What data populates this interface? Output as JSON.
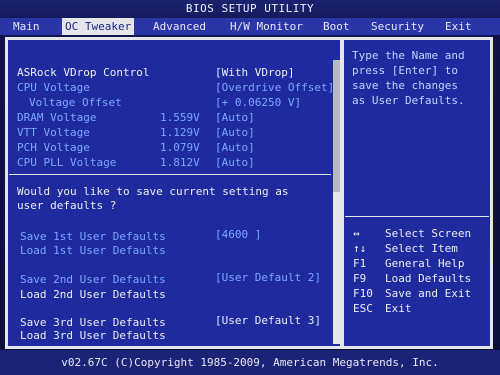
{
  "title": "BIOS SETUP UTILITY",
  "menu": [
    "Main",
    "OC Tweaker",
    "Advanced",
    "H/W Monitor",
    "Boot",
    "Security",
    "Exit"
  ],
  "settings": [
    {
      "label": "ASRock VDrop Control",
      "reading": "",
      "value": "[With VDrop]"
    },
    {
      "label": "CPU Voltage",
      "reading": "",
      "value": "[Overdrive Offset]"
    },
    {
      "label": "Voltage Offset",
      "reading": "",
      "value": "[+  0.06250 V]"
    },
    {
      "label": "DRAM Voltage",
      "reading": "1.559V",
      "value": "[Auto]"
    },
    {
      "label": "VTT Voltage",
      "reading": "1.129V",
      "value": "[Auto]"
    },
    {
      "label": "PCH Voltage",
      "reading": "1.079V",
      "value": "[Auto]"
    },
    {
      "label": "CPU PLL Voltage",
      "reading": "1.812V",
      "value": "[Auto]"
    }
  ],
  "save_prompt": [
    "Would you like to save current setting as",
    "user defaults ?"
  ],
  "user_defaults": [
    {
      "save_label": "Save 1st User Defaults",
      "save_value": "[4600        ]",
      "load_label": "Load 1st User Defaults"
    },
    {
      "save_label": "Save 2nd User Defaults",
      "save_value": "[User Default  2]",
      "load_label": "Load 2nd User Defaults"
    },
    {
      "save_label": "Save 3rd User Defaults",
      "save_value": "[User Default  3]",
      "load_label": "Load 3rd User Defaults"
    }
  ],
  "help_text": [
    "Type the Name and",
    "press [Enter] to",
    "save the changes",
    "as User Defaults."
  ],
  "keys": [
    {
      "key": "↔",
      "desc": "Select Screen"
    },
    {
      "key": "↑↓",
      "desc": "Select Item"
    },
    {
      "key": "F1",
      "desc": "General Help"
    },
    {
      "key": "F9",
      "desc": "Load Defaults"
    },
    {
      "key": "F10",
      "desc": "Save and Exit"
    },
    {
      "key": "ESC",
      "desc": "Exit"
    }
  ],
  "footer": "v02.67C (C)Copyright 1985-2009, American Megatrends, Inc."
}
